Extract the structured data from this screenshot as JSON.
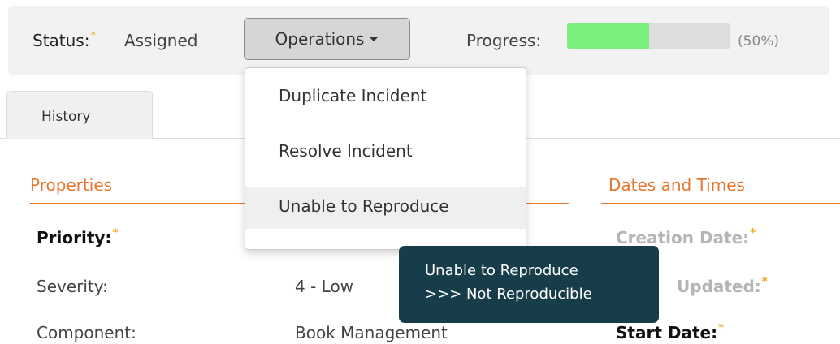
{
  "toolbar": {
    "status_label": "Status:",
    "status_value": "Assigned",
    "operations_label": "Operations",
    "progress_label": "Progress:",
    "progress_percent_text": "(50%)",
    "progress_fraction": 0.5
  },
  "required_marker": "*",
  "tabs": [
    {
      "label": "History"
    }
  ],
  "sections": {
    "properties": "Properties",
    "dates": "Dates and Times"
  },
  "fields": {
    "priority": {
      "label": "Priority:"
    },
    "severity": {
      "label": "Severity:",
      "value": "4 - Low"
    },
    "component": {
      "label": "Component:",
      "value": "Book Management"
    },
    "creation_date": {
      "label": "Creation Date:"
    },
    "last_updated": {
      "label": "Updated:"
    },
    "start_date": {
      "label": "Start Date:"
    }
  },
  "operations_menu": {
    "items": [
      {
        "label": "Duplicate Incident"
      },
      {
        "label": "Resolve Incident"
      },
      {
        "label": "Unable to Reproduce"
      }
    ],
    "hovered_index": 2
  },
  "tooltip": {
    "line1": "Unable to Reproduce",
    "line2": ">>> Not Reproducible"
  },
  "colors": {
    "accent": "#e8752d",
    "required_star": "#f39c12",
    "progress_fill": "#7cf07c",
    "tooltip_bg": "#173c4a"
  }
}
